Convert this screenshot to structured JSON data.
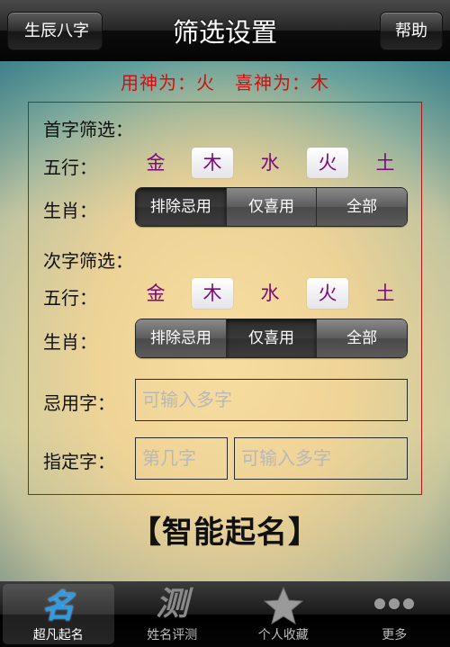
{
  "nav": {
    "title": "筛选设置",
    "back_label": "生辰八字",
    "help_label": "帮助"
  },
  "god_line": {
    "useful": "用神为：火",
    "happy": "喜神为：木"
  },
  "first_char": {
    "heading": "首字筛选：",
    "wuxing_label": "五行：",
    "elements": [
      {
        "label": "金",
        "selected": false
      },
      {
        "label": "木",
        "selected": true
      },
      {
        "label": "水",
        "selected": false
      },
      {
        "label": "火",
        "selected": true
      },
      {
        "label": "土",
        "selected": false
      }
    ],
    "zodiac_label": "生肖：",
    "segments": [
      "排除忌用",
      "仅喜用",
      "全部"
    ],
    "segment_selected": "排除忌用"
  },
  "second_char": {
    "heading": "次字筛选：",
    "wuxing_label": "五行：",
    "elements": [
      {
        "label": "金",
        "selected": false
      },
      {
        "label": "木",
        "selected": true
      },
      {
        "label": "水",
        "selected": false
      },
      {
        "label": "火",
        "selected": true
      },
      {
        "label": "土",
        "selected": false
      }
    ],
    "zodiac_label": "生肖：",
    "segments": [
      "排除忌用",
      "仅喜用",
      "全部"
    ],
    "segment_selected": "仅喜用"
  },
  "avoid": {
    "label": "忌用字：",
    "placeholder": "可输入多字"
  },
  "specify": {
    "label": "指定字：",
    "position_placeholder": "第几字",
    "chars_placeholder": "可输入多字"
  },
  "action_title": "【智能起名】",
  "tabs": [
    {
      "label": "超凡起名",
      "icon": "name-glyph-icon",
      "glyph": "名",
      "active": true
    },
    {
      "label": "姓名评测",
      "icon": "test-glyph-icon",
      "glyph": "测",
      "active": false
    },
    {
      "label": "个人收藏",
      "icon": "star-icon",
      "active": false
    },
    {
      "label": "更多",
      "icon": "more-dots-icon",
      "active": false
    }
  ],
  "colors": {
    "accent_red": "#d01010",
    "element_purple": "#7a0a7a",
    "tab_active_blue": "#2e9be6"
  }
}
